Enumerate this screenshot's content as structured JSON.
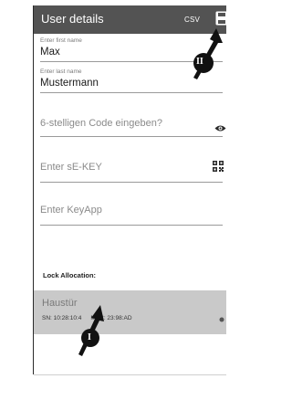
{
  "header": {
    "title": "User details",
    "csv_label": "CSV",
    "save_icon": "save-icon"
  },
  "form": {
    "first_name": {
      "label": "Enter first name",
      "value": "Max"
    },
    "last_name": {
      "label": "Enter last name",
      "value": "Mustermann"
    },
    "code": {
      "placeholder": "6-stelligen Code eingeben?",
      "icon": "eye-icon"
    },
    "se_key": {
      "placeholder": "Enter sE-KEY",
      "icon": "qr-code-icon"
    },
    "key_app": {
      "placeholder": "Enter KeyApp"
    }
  },
  "lock_allocation": {
    "section_label": "Lock Allocation:",
    "items": [
      {
        "name": "Haustür",
        "serial_prefix": "SN: 10:28:10:4",
        "mac": "MAC: 23:98:AD"
      }
    ]
  },
  "callouts": [
    {
      "label": "II",
      "target": "save-icon"
    },
    {
      "label": "I",
      "target": "lock-item"
    }
  ],
  "colors": {
    "topbar": "#535353",
    "selected_item": "#c9c9c9"
  }
}
